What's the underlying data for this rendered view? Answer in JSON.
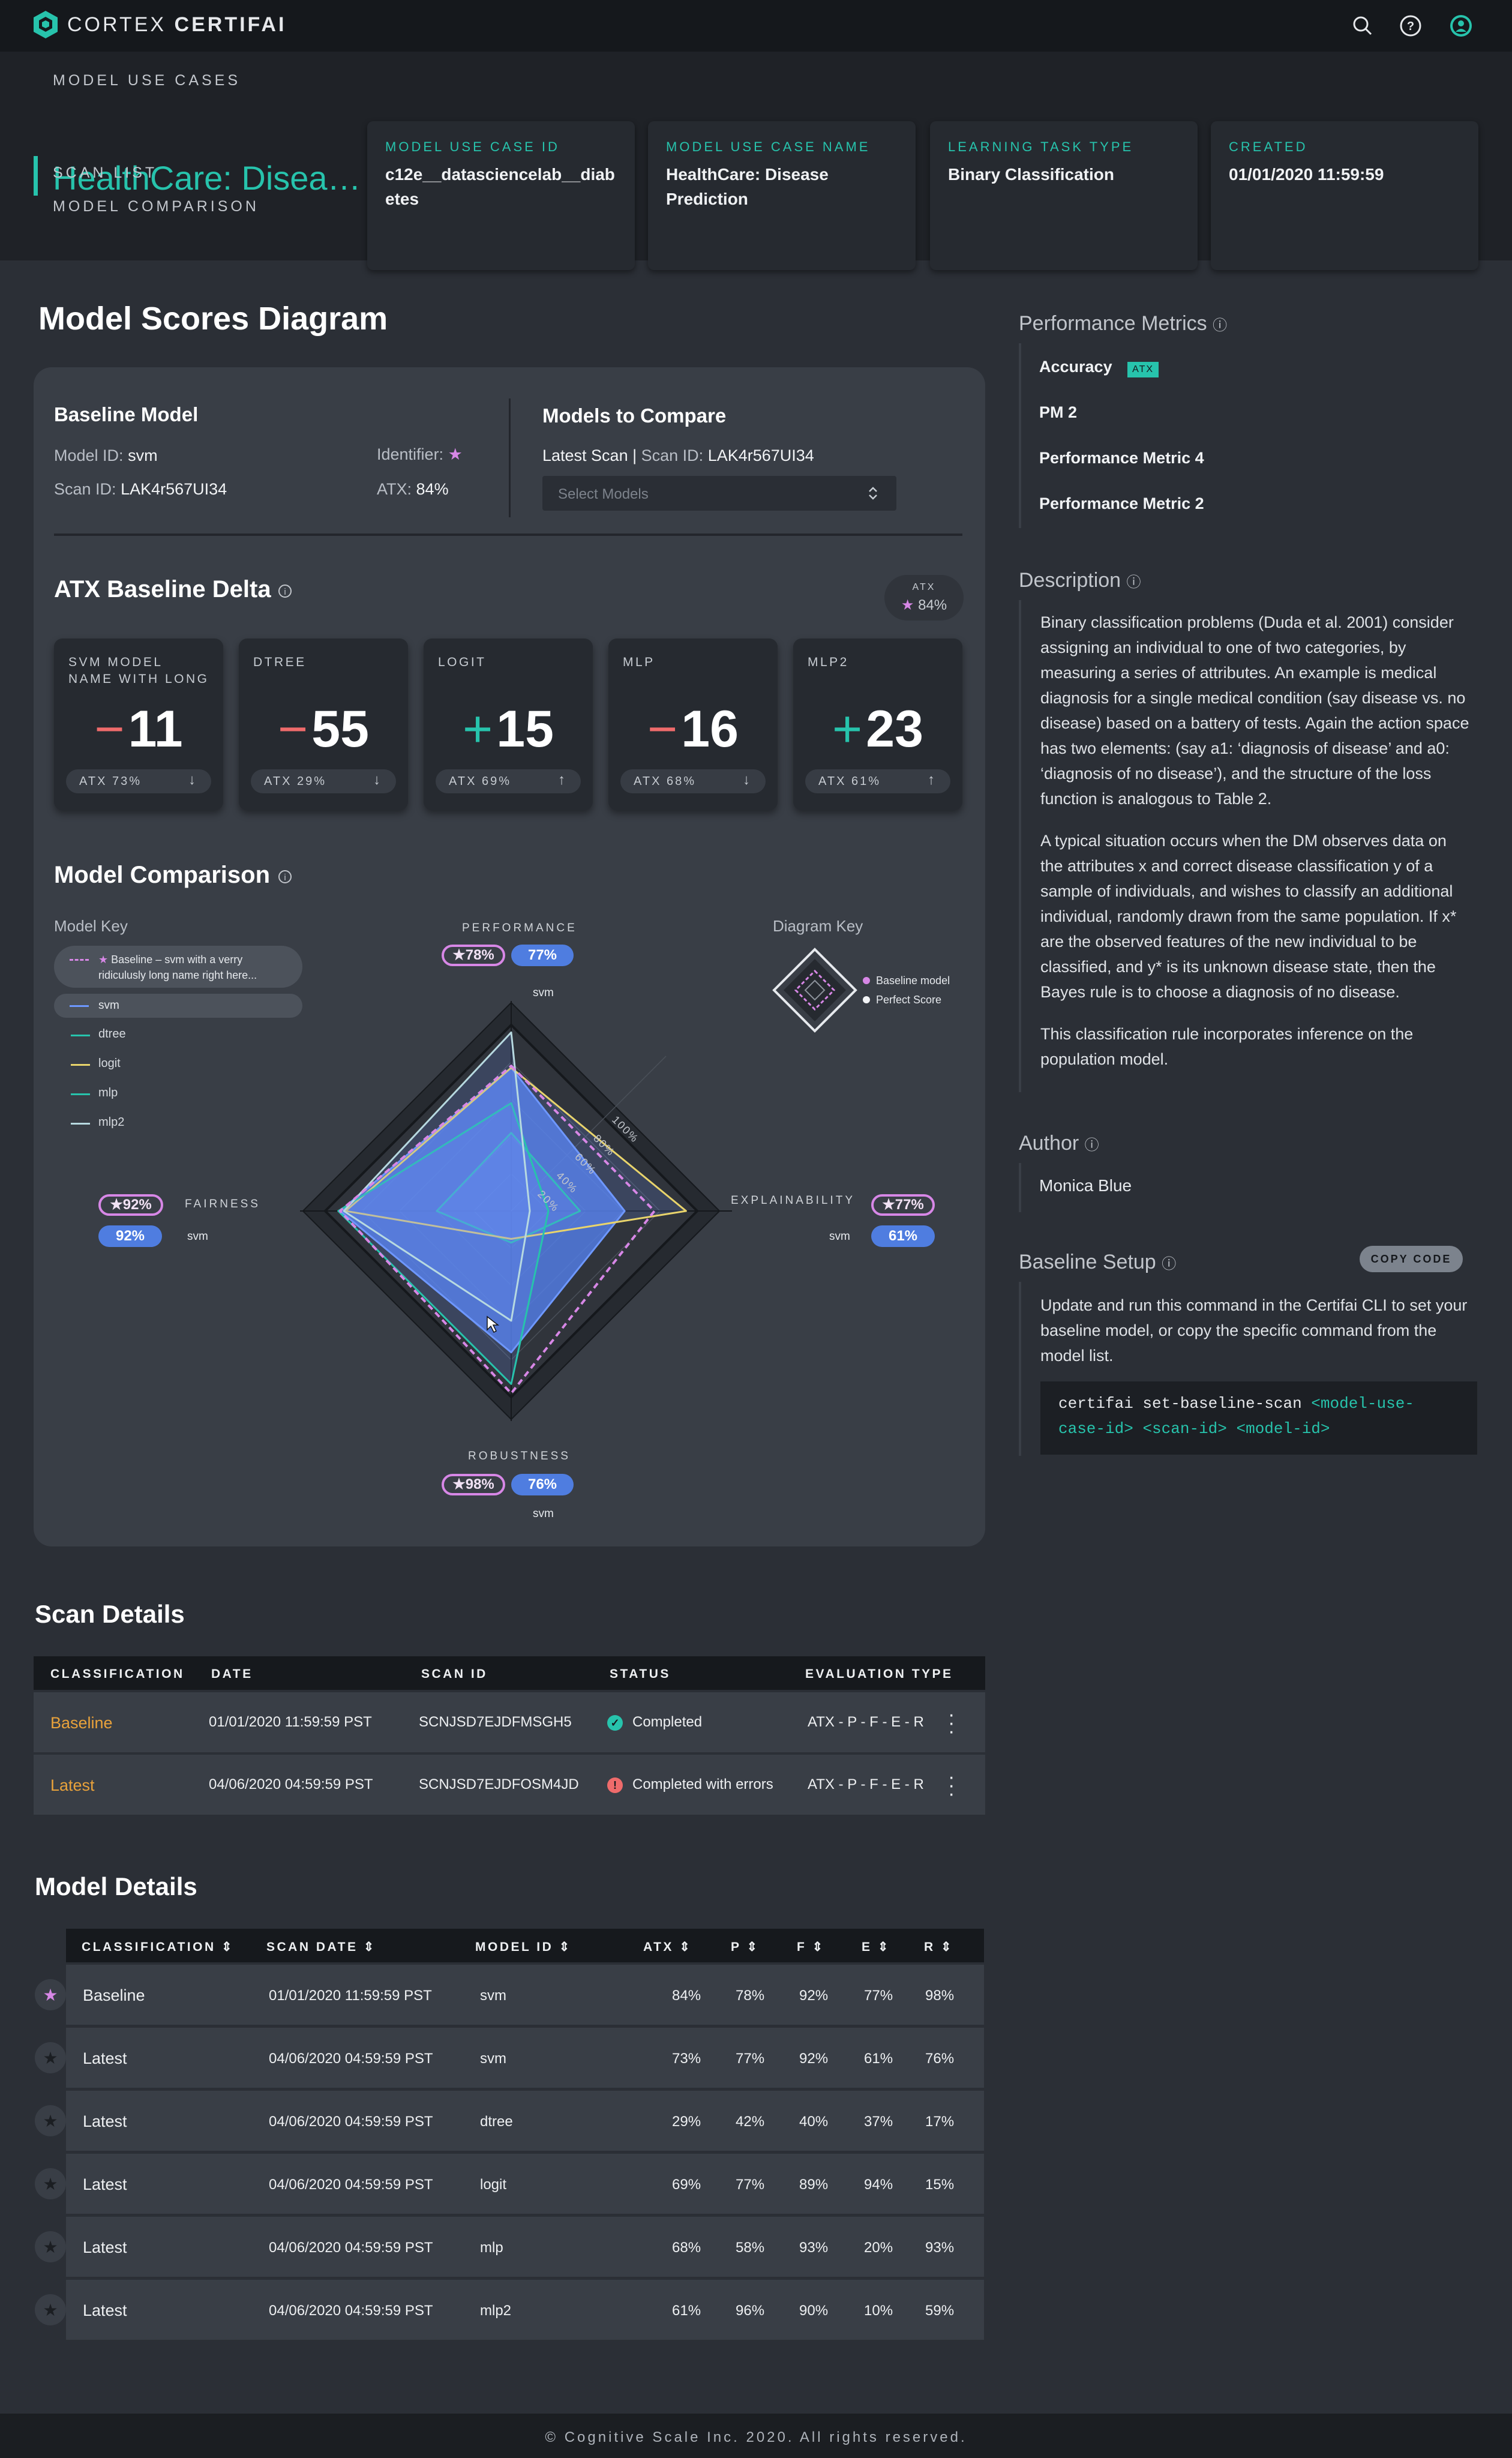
{
  "app": {
    "name_light": "CORTEX",
    "name_bold": "CERTIFAI"
  },
  "nav": {
    "section_label": "MODEL USE CASES",
    "active_item": "HealthCare: Diseas...",
    "scan_list": "SCAN LIST",
    "model_comparison": "MODEL COMPARISON"
  },
  "header_cards": [
    {
      "label": "MODEL USE CASE ID",
      "value": "c12e__datasciencelab__diabetes"
    },
    {
      "label": "MODEL USE CASE NAME",
      "value": "HealthCare: Disease Prediction"
    },
    {
      "label": "LEARNING TASK TYPE",
      "value": "Binary Classification"
    },
    {
      "label": "CREATED",
      "value": "01/01/2020 11:59:59"
    }
  ],
  "page_title": "Model Scores Diagram",
  "baseline": {
    "title": "Baseline Model",
    "model_id_label": "Model ID:",
    "model_id": "svm",
    "identifier_label": "Identifier:",
    "scan_id_label": "Scan ID:",
    "scan_id": "LAK4r567UI34",
    "atx_label": "ATX:",
    "atx": "84%"
  },
  "compare": {
    "title": "Models to Compare",
    "latest_scan_label": "Latest Scan",
    "sep": "|",
    "scan_id_label": "Scan ID:",
    "scan_id": "LAK4r567UI34",
    "select_placeholder": "Select Models"
  },
  "atx_delta": {
    "title": "ATX Baseline Delta",
    "badge_label": "ATX",
    "badge_value": "84%",
    "cards": [
      {
        "name": "SVM MODEL NAME WITH LONG TEXT...",
        "sign": "−",
        "value": "11",
        "atx": "ATX 73%",
        "arrow": "↓",
        "dir": "down"
      },
      {
        "name": "DTREE",
        "sign": "−",
        "value": "55",
        "atx": "ATX 29%",
        "arrow": "↓",
        "dir": "down"
      },
      {
        "name": "LOGIT",
        "sign": "+",
        "value": "15",
        "atx": "ATX 69%",
        "arrow": "↑",
        "dir": "up"
      },
      {
        "name": "MLP",
        "sign": "−",
        "value": "16",
        "atx": "ATX 68%",
        "arrow": "↓",
        "dir": "down"
      },
      {
        "name": "MLP2",
        "sign": "+",
        "value": "23",
        "atx": "ATX 61%",
        "arrow": "↑",
        "dir": "up"
      }
    ]
  },
  "comparison": {
    "title": "Model Comparison",
    "model_key_title": "Model Key",
    "diagram_key_title": "Diagram Key",
    "diagram_key": {
      "baseline": "Baseline model",
      "perfect": "Perfect Score"
    },
    "model_key": [
      {
        "name": "Baseline – svm with a verry ridiculusly long name right here...",
        "color": "#d787e6",
        "style": "dashed"
      },
      {
        "name": "svm",
        "color": "#6e98ff",
        "style": "solid"
      },
      {
        "name": "dtree",
        "color": "#27c3ac",
        "style": "solid"
      },
      {
        "name": "logit",
        "color": "#e9d46b",
        "style": "solid"
      },
      {
        "name": "mlp",
        "color": "#27c3ac",
        "style": "solid"
      },
      {
        "name": "mlp2",
        "color": "#b7d9e0",
        "style": "solid"
      }
    ],
    "axes": {
      "performance": {
        "label": "PERFORMANCE",
        "baseline": "78%",
        "model": "77%",
        "model_name": "svm"
      },
      "fairness": {
        "label": "FAIRNESS",
        "baseline": "92%",
        "model": "92%",
        "model_name": "svm"
      },
      "explainability": {
        "label": "EXPLAINABILITY",
        "baseline": "77%",
        "model": "61%",
        "model_name": "svm"
      },
      "robustness": {
        "label": "ROBUSTNESS",
        "baseline": "98%",
        "model": "76%",
        "model_name": "svm"
      }
    },
    "ring_labels": [
      "100%",
      "80%",
      "60%",
      "40%",
      "20%"
    ]
  },
  "chart_data": {
    "type": "radar",
    "axes": [
      "PERFORMANCE",
      "EXPLAINABILITY",
      "ROBUSTNESS",
      "FAIRNESS"
    ],
    "rlim": [
      0,
      100
    ],
    "series": [
      {
        "name": "Baseline – svm with a verry ridiculusly long name right here...",
        "values": [
          78,
          77,
          98,
          92
        ]
      },
      {
        "name": "svm",
        "values": [
          77,
          61,
          76,
          92
        ]
      },
      {
        "name": "dtree",
        "values": [
          42,
          37,
          17,
          40
        ]
      },
      {
        "name": "logit",
        "values": [
          77,
          94,
          15,
          89
        ]
      },
      {
        "name": "mlp",
        "values": [
          58,
          20,
          93,
          93
        ]
      },
      {
        "name": "mlp2",
        "values": [
          96,
          10,
          59,
          90
        ]
      }
    ]
  },
  "scan_details": {
    "title": "Scan Details",
    "headers": [
      "CLASSIFICATION",
      "DATE",
      "SCAN ID",
      "STATUS",
      "EVALUATION TYPE"
    ],
    "rows": [
      {
        "classification": "Baseline",
        "date": "01/01/2020 11:59:59 PST",
        "scan_id": "SCNJSD7EJDFMSGH5",
        "status": "Completed",
        "status_type": "ok",
        "eval": "ATX - P - F - E - R"
      },
      {
        "classification": "Latest",
        "date": "04/06/2020 04:59:59 PST",
        "scan_id": "SCNJSD7EJDFOSM4JD",
        "status": "Completed with errors",
        "status_type": "error",
        "eval": "ATX - P - F - E - R"
      }
    ]
  },
  "model_details": {
    "title": "Model Details",
    "headers": [
      "CLASSIFICATION",
      "SCAN DATE",
      "MODEL ID",
      "ATX",
      "P",
      "F",
      "E",
      "R"
    ],
    "rows": [
      {
        "classification": "Baseline",
        "date": "01/01/2020 11:59:59 PST",
        "model": "svm",
        "atx": "84%",
        "p": "78%",
        "f": "92%",
        "e": "77%",
        "r": "98%",
        "starred": true
      },
      {
        "classification": "Latest",
        "date": "04/06/2020 04:59:59 PST",
        "model": "svm",
        "atx": "73%",
        "p": "77%",
        "f": "92%",
        "e": "61%",
        "r": "76%",
        "starred": false
      },
      {
        "classification": "Latest",
        "date": "04/06/2020 04:59:59 PST",
        "model": "dtree",
        "atx": "29%",
        "p": "42%",
        "f": "40%",
        "e": "37%",
        "r": "17%",
        "starred": false
      },
      {
        "classification": "Latest",
        "date": "04/06/2020 04:59:59 PST",
        "model": "logit",
        "atx": "69%",
        "p": "77%",
        "f": "89%",
        "e": "94%",
        "r": "15%",
        "starred": false
      },
      {
        "classification": "Latest",
        "date": "04/06/2020 04:59:59 PST",
        "model": "mlp",
        "atx": "68%",
        "p": "58%",
        "f": "93%",
        "e": "20%",
        "r": "93%",
        "starred": false
      },
      {
        "classification": "Latest",
        "date": "04/06/2020 04:59:59 PST",
        "model": "mlp2",
        "atx": "61%",
        "p": "96%",
        "f": "90%",
        "e": "10%",
        "r": "59%",
        "starred": false
      }
    ]
  },
  "right_panel": {
    "metrics_title": "Performance Metrics",
    "metrics": [
      {
        "name": "Accuracy",
        "badge": "ATX"
      },
      {
        "name": "PM 2"
      },
      {
        "name": "Performance Metric 4"
      },
      {
        "name": "Performance Metric 2"
      }
    ],
    "description_title": "Description",
    "description": [
      "Binary classification problems (Duda et al. 2001) consider assigning an individual to one of two categories, by measuring a series of attributes. An example is medical diagnosis for a single medical condition (say disease vs. no disease) based on a battery of tests. Again the action space has two elements: (say a1: ‘diagnosis of disease’ and a0: ‘diagnosis of no disease’), and the structure of the loss function is analogous to Table 2.",
      "A typical situation occurs when the DM observes data on the attributes x and correct disease classification y of a sample of individuals, and wishes to classify an additional individual, randomly drawn from the same population. If x* are the observed features of the new individual to be classified, and y* is its unknown disease state, then the Bayes rule is to choose a diagnosis of no disease.",
      "This classification rule incorporates inference on the population model."
    ],
    "author_title": "Author",
    "author": "Monica Blue",
    "setup_title": "Baseline Setup",
    "copy_label": "COPY CODE",
    "setup_text": "Update and run this command in the Certifai CLI to set your baseline model, or copy the specific command from the model list.",
    "code_cmd": "certifai set-baseline-scan",
    "code_a1": "<model-use-",
    "code_a2": "case-id>",
    "code_a3": "<scan-id>",
    "code_a4": "<model-id>"
  },
  "footer": "© Cognitive Scale Inc. 2020. All rights reserved.",
  "colors": {
    "accent": "#27c3ac",
    "baseline_pink": "#d787e6",
    "model_blue": "#4f7de0",
    "negative": "#ef6b6b",
    "positive": "#27c3ac",
    "baseline_orange": "#e9a23b"
  }
}
